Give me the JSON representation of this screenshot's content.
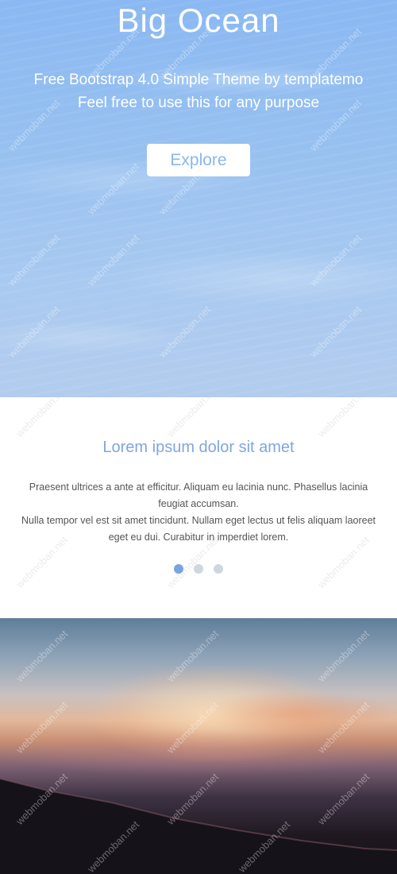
{
  "hero": {
    "title": "Big Ocean",
    "subtitle_line1": "Free Bootstrap 4.0 Simple Theme by templatemo",
    "subtitle_line2": "Feel free to use this for any purpose",
    "button_label": "Explore"
  },
  "content": {
    "title": "Lorem ipsum dolor sit amet",
    "paragraph1": "Praesent ultrices a ante at efficitur. Aliquam eu lacinia nunc. Phasellus lacinia feugiat accumsan.",
    "paragraph2": "Nulla tempor vel est sit amet tincidunt. Nullam eget lectus ut felis aliquam laoreet eget eu dui. Curabitur in imperdiet lorem.",
    "slides": 3,
    "active_slide": 1
  },
  "watermark": "webmoban.net",
  "colors": {
    "accent": "#7ea7de",
    "hero_sky": "#96c0f0",
    "dot_inactive": "#cfd6df",
    "dot_active": "#7aa4df"
  }
}
